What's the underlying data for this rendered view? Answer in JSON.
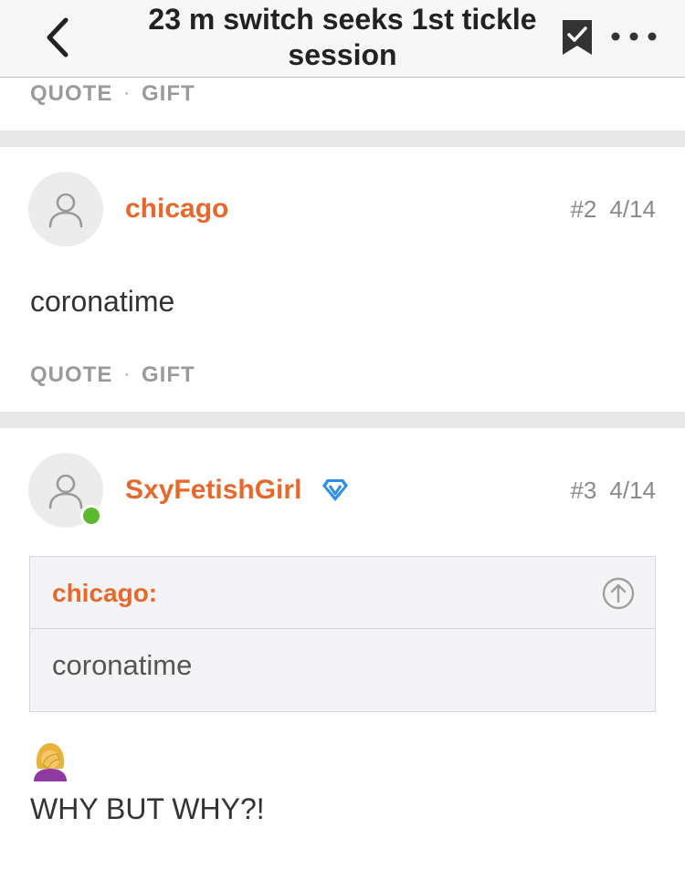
{
  "header": {
    "title": "23 m switch seeks 1st tickle session",
    "back_icon": "chevron-left-icon",
    "bookmark_icon": "bookmark-check-icon",
    "more_icon": "ellipsis-icon"
  },
  "actions": {
    "quote": "QUOTE",
    "separator": "·",
    "gift": "GIFT"
  },
  "posts": [
    {
      "username": "chicago",
      "number": "#2",
      "date": "4/14",
      "text": "coronatime"
    },
    {
      "username": "SxyFetishGirl",
      "verified_icon": "diamond-v-badge-icon",
      "online": true,
      "number": "#3",
      "date": "4/14",
      "quote": {
        "author": "chicago:",
        "text": "coronatime"
      },
      "emoji": "woman-facepalming-emoji",
      "text": "WHY BUT WHY?!"
    }
  ],
  "colors": {
    "accent": "#e8672a",
    "online": "#5cb82c",
    "verified": "#2e8ee8"
  }
}
